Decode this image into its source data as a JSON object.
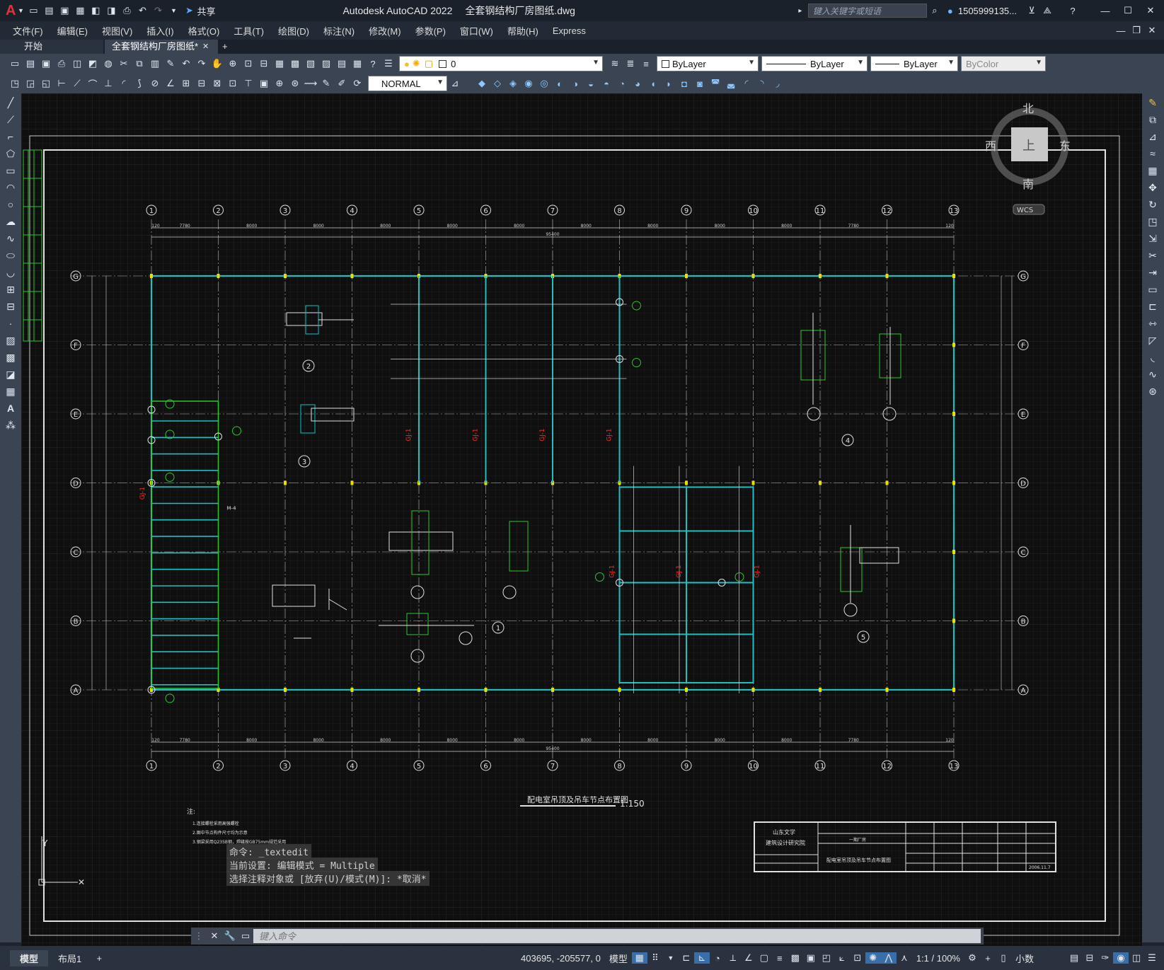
{
  "app": {
    "title": "Autodesk AutoCAD 2022",
    "file": "全套钢结构厂房图纸.dwg",
    "search_placeholder": "键入关键字或短语",
    "user": "1505999135...",
    "logo": "A"
  },
  "quick_access": {
    "share": "共享"
  },
  "menu": [
    "文件(F)",
    "编辑(E)",
    "视图(V)",
    "插入(I)",
    "格式(O)",
    "工具(T)",
    "绘图(D)",
    "标注(N)",
    "修改(M)",
    "参数(P)",
    "窗口(W)",
    "帮助(H)",
    "Express"
  ],
  "tabs": {
    "start": "开始",
    "active": "全套钢结构厂房图纸*",
    "add": "+"
  },
  "layers": {
    "current": "0",
    "color": "ByLayer",
    "linetype": "ByLayer",
    "lineweight": "ByLayer",
    "plot": "ByColor"
  },
  "dimstyle": "NORMAL",
  "viewcube": {
    "north": "北",
    "south": "南",
    "east": "东",
    "west": "西",
    "top": "上",
    "wcs": "WCS"
  },
  "drawing": {
    "title": "配电室吊顶及吊车节点布置图",
    "scale": "1:150",
    "grid_cols": [
      "1",
      "2",
      "3",
      "4",
      "5",
      "6",
      "7",
      "8",
      "9",
      "10",
      "11",
      "12",
      "13"
    ],
    "grid_rows": [
      "G",
      "F",
      "E",
      "D",
      "C",
      "B",
      "A"
    ],
    "dims_top": [
      "120",
      "7780",
      "8000",
      "8000",
      "8000",
      "8000",
      "8000",
      "8000",
      "8000",
      "8000",
      "8000",
      "7780",
      "120"
    ],
    "total_width": "95400",
    "detail_labels": [
      "1",
      "2",
      "3",
      "4",
      "5"
    ],
    "gj": "GJ-1",
    "m4": "M-4",
    "notes_title": "注:",
    "notes": [
      "1.连接螺栓采用高强螺栓",
      "2.图中节点构件尺寸均为示意",
      "3.钢梁采用Q235B钢，焊缝按GB75mm规范采用"
    ],
    "titleblock": {
      "org1": "山东文学",
      "org2": "建筑设计研究院",
      "project": "一期厂房",
      "sheet": "配电室吊顶及吊车节点布置图",
      "date": "2006.11.7"
    }
  },
  "command": {
    "history1": "命令: _textedit",
    "history2": "当前设置: 编辑模式 = Multiple",
    "history3": "选择注释对象或 [放弃(U)/模式(M)]: *取消*",
    "placeholder": "键入命令"
  },
  "status": {
    "model_tab": "模型",
    "layout_tab": "布局1",
    "coords": "403695, -205577, 0",
    "space": "模型",
    "scale": "1:1 / 100%",
    "units": "小数"
  }
}
